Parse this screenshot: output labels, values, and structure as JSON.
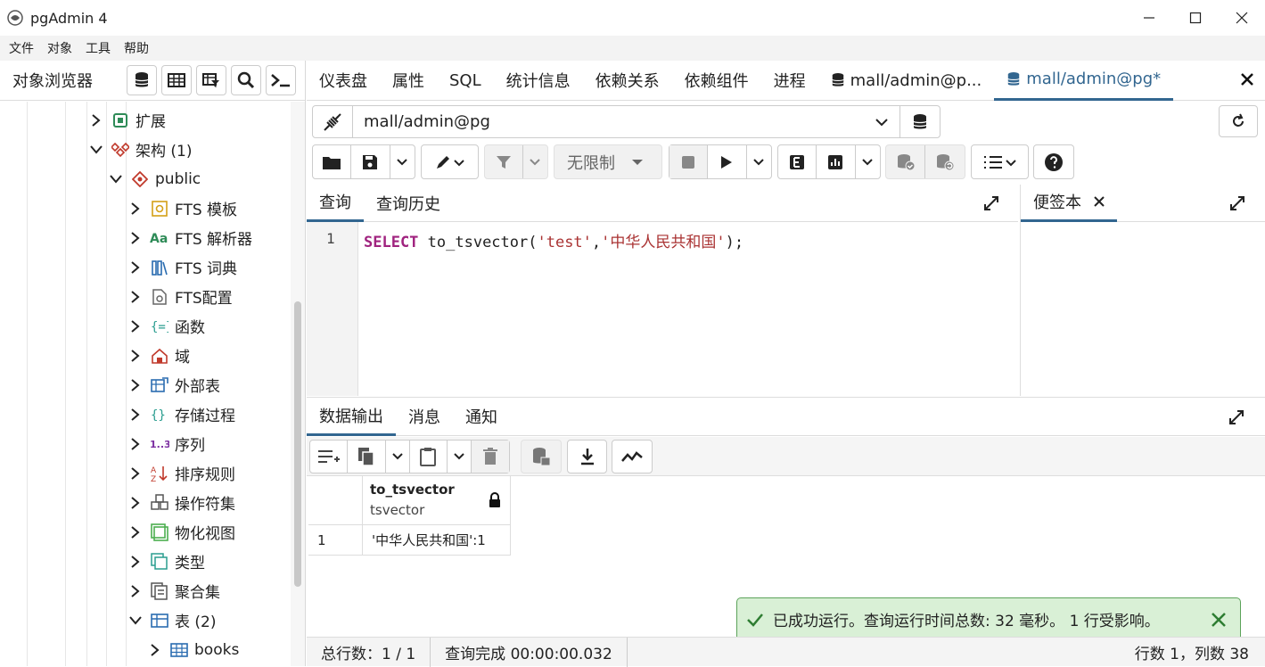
{
  "window": {
    "title": "pgAdmin 4"
  },
  "menu": [
    "文件",
    "对象",
    "工具",
    "帮助"
  ],
  "browser": {
    "title": "对象浏览器",
    "tree": [
      {
        "label": "扩展",
        "icon": "extension-icon",
        "level": 0,
        "expanded": false
      },
      {
        "label": "架构 (1)",
        "icon": "schemas-icon",
        "level": 0,
        "expanded": true
      },
      {
        "label": "public",
        "icon": "schema-icon",
        "level": 1,
        "expanded": true
      },
      {
        "label": "FTS 模板",
        "icon": "fts-template-icon",
        "level": 2,
        "expanded": false
      },
      {
        "label": "FTS 解析器",
        "icon": "fts-parser-icon",
        "level": 2,
        "expanded": false
      },
      {
        "label": "FTS 词典",
        "icon": "fts-dictionary-icon",
        "level": 2,
        "expanded": false
      },
      {
        "label": "FTS配置",
        "icon": "fts-config-icon",
        "level": 2,
        "expanded": false
      },
      {
        "label": "函数",
        "icon": "function-icon",
        "level": 2,
        "expanded": false
      },
      {
        "label": "域",
        "icon": "domain-icon",
        "level": 2,
        "expanded": false
      },
      {
        "label": "外部表",
        "icon": "foreign-table-icon",
        "level": 2,
        "expanded": false
      },
      {
        "label": "存储过程",
        "icon": "procedure-icon",
        "level": 2,
        "expanded": false
      },
      {
        "label": "序列",
        "icon": "sequence-icon",
        "level": 2,
        "expanded": false
      },
      {
        "label": "排序规则",
        "icon": "collation-icon",
        "level": 2,
        "expanded": false
      },
      {
        "label": "操作符集",
        "icon": "operator-icon",
        "level": 2,
        "expanded": false
      },
      {
        "label": "物化视图",
        "icon": "materialized-view-icon",
        "level": 2,
        "expanded": false
      },
      {
        "label": "类型",
        "icon": "type-icon",
        "level": 2,
        "expanded": false
      },
      {
        "label": "聚合集",
        "icon": "aggregate-icon",
        "level": 2,
        "expanded": false
      },
      {
        "label": "表 (2)",
        "icon": "tables-icon",
        "level": 2,
        "expanded": true
      },
      {
        "label": "books",
        "icon": "table-icon",
        "level": 3,
        "expanded": false
      }
    ]
  },
  "tabs": [
    "仪表盘",
    "属性",
    "SQL",
    "统计信息",
    "依赖关系",
    "依赖组件",
    "进程",
    "mall/admin@p...",
    "mall/admin@pg*"
  ],
  "connection": "mall/admin@pg",
  "limit": "无限制",
  "query_tabs": [
    "查询",
    "查询历史"
  ],
  "notes_tab": "便签本",
  "editor": {
    "line_number": "1",
    "keyword": "SELECT",
    "func": " to_tsvector(",
    "arg1": "'test'",
    "comma": ",",
    "arg2": "'中华人民共和国'",
    "end": ");"
  },
  "output_tabs": [
    "数据输出",
    "消息",
    "通知"
  ],
  "result": {
    "column_name": "to_tsvector",
    "column_type": "tsvector",
    "row_number": "1",
    "value": "'中华人民共和国':1"
  },
  "toast": "已成功运行。查询运行时间总数: 32 毫秒。 1 行受影响。",
  "status": {
    "total_rows": "总行数：1 / 1",
    "query_complete": "查询完成 00:00:00.032",
    "position": "行数 1，列数 38"
  },
  "colors": {
    "accent": "#326690",
    "keyword": "#a0237f",
    "string": "#a33",
    "toast_bg": "#d9f0d6"
  }
}
